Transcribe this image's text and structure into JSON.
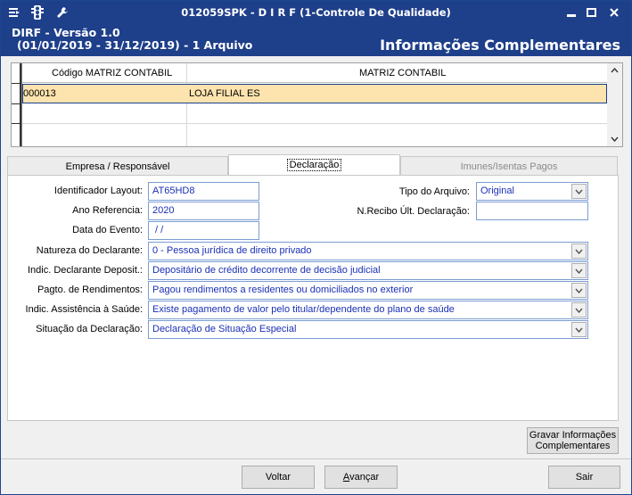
{
  "titlebar": {
    "title": "012059SPK - D I R F (1-Controle De Qualidade)",
    "icons": [
      "menu-icon",
      "traffic-light-icon",
      "wrench-icon"
    ],
    "minimize": "▬",
    "maximize": "□",
    "close": "✕"
  },
  "header": {
    "line1": "DIRF - Versão 1.0",
    "line2": "(01/01/2019 - 31/12/2019) - 1 Arquivo",
    "right_title": "Informações Complementares"
  },
  "grid": {
    "columns": [
      "Código MATRIZ CONTABIL",
      "MATRIZ CONTABIL"
    ],
    "rows": [
      {
        "code": "000013",
        "name": "LOJA FILIAL ES"
      }
    ]
  },
  "tabs": [
    {
      "label": "Empresa / Responsável",
      "state": "normal"
    },
    {
      "label": "Declaração",
      "state": "active"
    },
    {
      "label": "Imunes/Isentas Pagos",
      "state": "disabled"
    }
  ],
  "form": {
    "identificador_layout": {
      "label": "Identificador Layout:",
      "value": "AT65HD8"
    },
    "ano_referencia": {
      "label": "Ano Referencia:",
      "value": "2020"
    },
    "data_evento": {
      "label": "Data do Evento:",
      "value": " / /"
    },
    "tipo_arquivo": {
      "label": "Tipo do Arquivo:",
      "value": "Original"
    },
    "nrecibo": {
      "label": "N.Recibo Últ. Declaração:",
      "value": ""
    },
    "natureza": {
      "label": "Natureza do Declarante:",
      "value": "0 - Pessoa jurídica de direito privado"
    },
    "indic_deposit": {
      "label": "Indic. Declarante Deposit.:",
      "value": "Depositário de crédito decorrente de decisão judicial"
    },
    "pagto": {
      "label": "Pagto. de Rendimentos:",
      "value": "Pagou rendimentos a residentes ou domiciliados no exterior"
    },
    "assistencia": {
      "label": "Indic. Assistência à Saúde:",
      "value": "Existe pagamento de valor pelo titular/dependente do plano de saúde"
    },
    "situacao": {
      "label": "Situação da Declaração:",
      "value": "Declaração de Situação Especial"
    }
  },
  "buttons": {
    "gravar_line1": "Gravar Informações",
    "gravar_line2": "Complementares",
    "voltar": "Voltar",
    "avancar_u": "A",
    "avancar_rest": "vançar",
    "sair": "Sair"
  },
  "colors": {
    "titlebar": "#1e3f8a",
    "selected_row": "#fde3ae",
    "field_text": "#1a2fb5",
    "field_border": "#7a9cd3"
  }
}
